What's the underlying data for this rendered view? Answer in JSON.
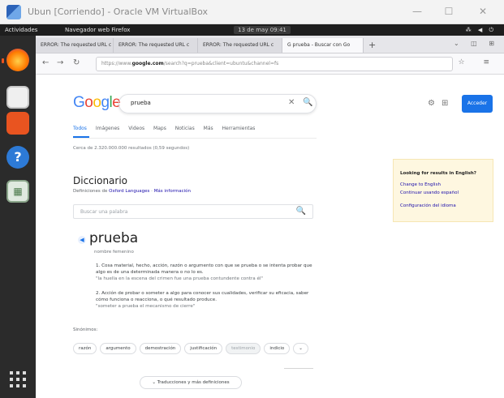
{
  "vbox": {
    "title": "Ubun [Corriendo] - Oracle VM VirtualBox",
    "min": "—",
    "max": "☐",
    "close": "✕"
  },
  "ubuntu": {
    "activities": "Actividades",
    "app_menu": "Navegador web Firefox",
    "clock": "13 de may 09:41",
    "tray": "⁂ ◀ ⏻"
  },
  "firefox": {
    "tabs": [
      "ERROR: The requested URL c",
      "ERROR: The requested URL c",
      "ERROR: The requested URL c",
      "G prueba - Buscar con Go"
    ],
    "new_tab": "+",
    "url_prefix": "https://www.",
    "url_domain": "google.com",
    "url_rest": "/search?q=prueba&client=ubuntu&channel=fs",
    "back": "←",
    "forward": "→",
    "reload": "↻",
    "nav_right": "☆ ≡",
    "tab_right": "⌄ ◫ ⊞"
  },
  "google": {
    "logo_letters": [
      "G",
      "o",
      "o",
      "g",
      "l",
      "e"
    ],
    "query": "prueba",
    "clear": "✕",
    "search_icon": "🔍",
    "apps_icon": "⊞",
    "settings_icon": "⚙",
    "signin": "Acceder",
    "tabs": [
      "Todos",
      "Imágenes",
      "Videos",
      "Maps",
      "Noticias",
      "Más",
      "Herramientas"
    ],
    "stats": "Cerca de 2.320.000.000 resultados (0,59 segundos)",
    "dictionary": {
      "title": "Diccionario",
      "source_prefix": "Definiciones de",
      "source_link": "Oxford Languages",
      "more_info": "Más información",
      "search_placeholder": "Buscar una palabra",
      "word": "prueba",
      "pos": "nombre femenino",
      "definitions": [
        {
          "num": "1.",
          "text": "Cosa material, hecho, acción, razón o argumento con que se prueba o se intenta probar que algo es de una determinada manera o no lo es.",
          "example": "\"la huella en la escena del crimen fue una prueba contundente contra él\""
        },
        {
          "num": "2.",
          "text": "Acción de probar o someter a algo para conocer sus cualidades, verificar su eficacia, saber cómo funciona o reacciona, o qué resultado produce.",
          "example": "\"someter a prueba el mecanismo de cierre\""
        }
      ],
      "synonyms_label": "Sinónimos:",
      "synonyms": [
        "razón",
        "argumento",
        "demostración",
        "justificación",
        "testimonio",
        "indicio",
        "⌄"
      ],
      "more_button": "⌄ Traducciones y más definiciones"
    },
    "english_box": {
      "heading": "Looking for results in English?",
      "links": [
        "Change to English",
        "Continuar usando español",
        "Configuración del idioma"
      ]
    }
  },
  "colors": {
    "google_blue": "#4285f4",
    "google_red": "#ea4335",
    "google_yellow": "#fbbc05",
    "google_green": "#34a853",
    "link": "#1a0dab",
    "accent": "#1a73e8"
  }
}
